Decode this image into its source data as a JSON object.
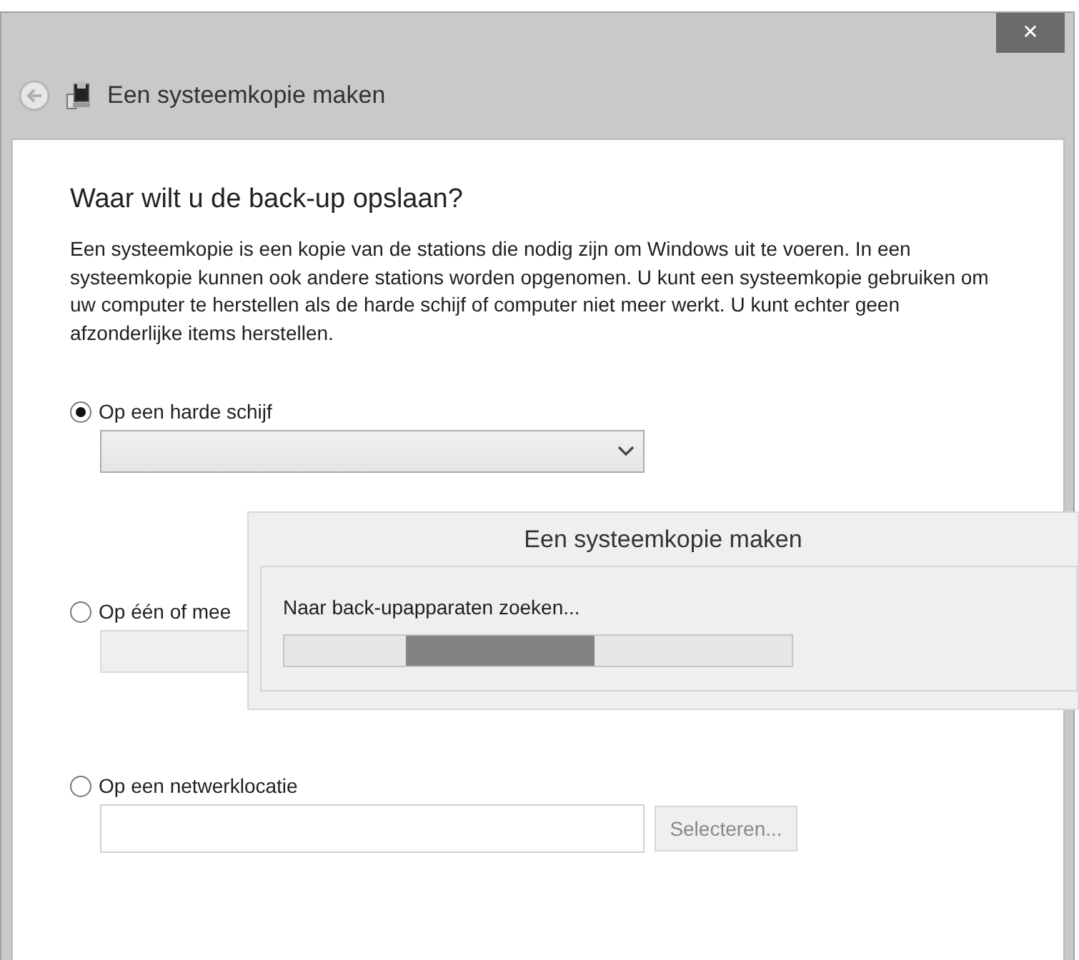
{
  "window": {
    "close": "✕",
    "title": "Een systeemkopie maken"
  },
  "heading": "Waar wilt u de back-up opslaan?",
  "description": "Een systeemkopie is een kopie van de stations die nodig zijn om Windows uit te voeren. In een systeemkopie kunnen ook andere stations worden opgenomen. U kunt een systeemkopie gebruiken om uw computer te herstellen als de harde schijf of computer niet meer werkt. U kunt echter geen afzonderlijke items herstellen.",
  "options": [
    {
      "label": "Op een harde schijf",
      "selected": true,
      "kind": "dropdown",
      "disabled": false
    },
    {
      "label": "Op één of mee",
      "selected": false,
      "kind": "dropdown",
      "disabled": true
    },
    {
      "label": "Op een netwerklocatie",
      "selected": false,
      "kind": "path",
      "button": "Selecteren...",
      "disabled": false
    }
  ],
  "progress_dialog": {
    "title": "Een systeemkopie maken",
    "message": "Naar back-upapparaten zoeken...",
    "level": 0.37
  }
}
